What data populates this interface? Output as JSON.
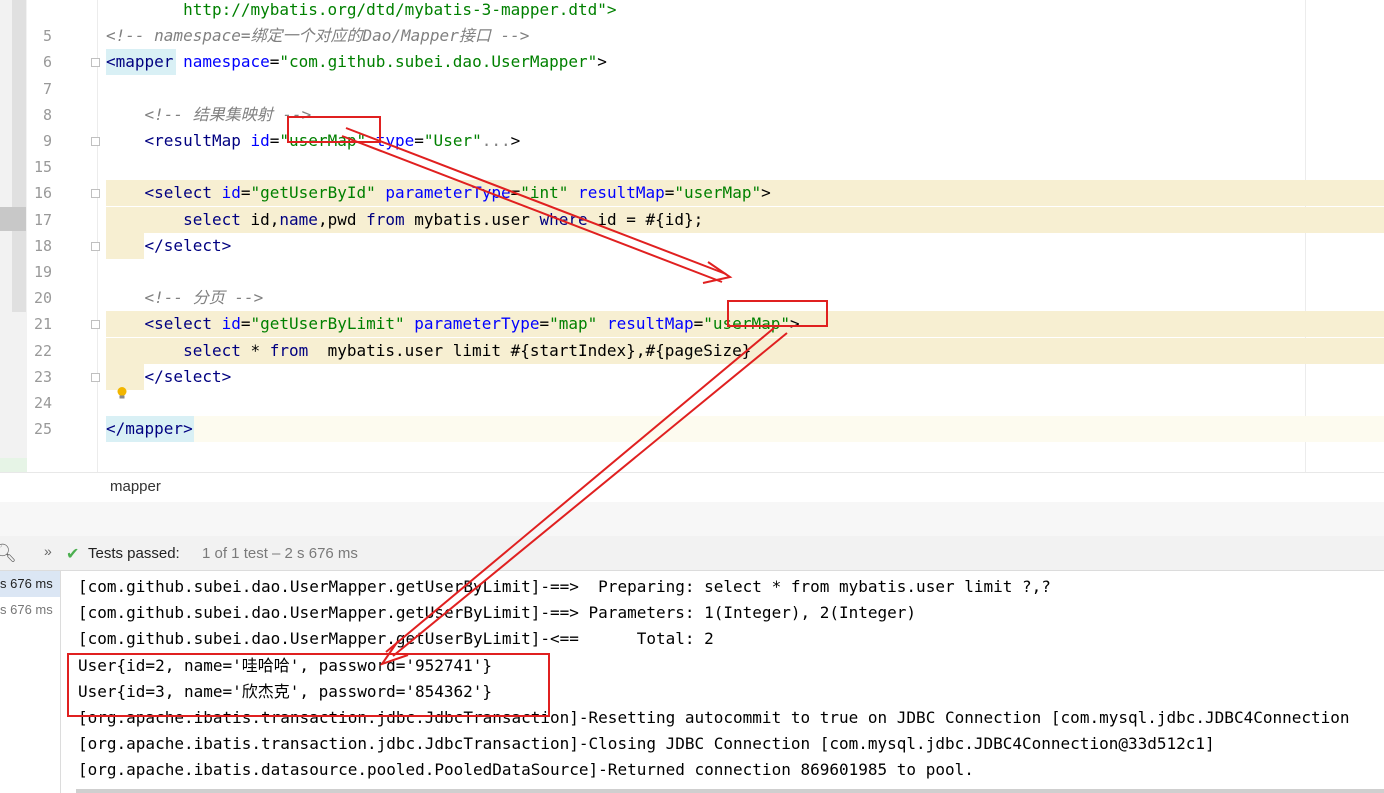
{
  "editor": {
    "lines": [
      {
        "num": "",
        "segments": [
          {
            "t": "        http://mybatis.org/dtd/mybatis-3-mapper.dtd\">",
            "c": "c-val"
          }
        ]
      },
      {
        "num": "5",
        "segments": [
          {
            "t": "<!-- namespace=绑定一个对应的Dao/Mapper接口 -->",
            "c": "c-comment"
          }
        ]
      },
      {
        "num": "6",
        "segments": [
          {
            "t": "<mapper",
            "c": "c-tag"
          },
          {
            "t": " namespace",
            "c": "c-attr"
          },
          {
            "t": "=",
            "c": ""
          },
          {
            "t": "\"com.github.subei.dao.UserMapper\"",
            "c": "c-val"
          },
          {
            "t": ">",
            "c": ""
          }
        ]
      },
      {
        "num": "7",
        "segments": []
      },
      {
        "num": "8",
        "segments": [
          {
            "t": "    <!-- 结果集映射 -->",
            "c": "c-comment"
          }
        ]
      },
      {
        "num": "9",
        "segments": [
          {
            "t": "    <resultMap",
            "c": "c-tag"
          },
          {
            "t": " id",
            "c": "c-attr"
          },
          {
            "t": "=",
            "c": ""
          },
          {
            "t": "\"userMap\"",
            "c": "c-val"
          },
          {
            "t": " type",
            "c": "c-attr"
          },
          {
            "t": "=",
            "c": ""
          },
          {
            "t": "\"User\"",
            "c": "c-val"
          },
          {
            "t": "...",
            "c": "c-dim"
          },
          {
            "t": ">",
            "c": ""
          }
        ]
      },
      {
        "num": "15",
        "segments": []
      },
      {
        "num": "16",
        "segments": [
          {
            "t": "    <select",
            "c": "c-tag"
          },
          {
            "t": " id",
            "c": "c-attr"
          },
          {
            "t": "=",
            "c": ""
          },
          {
            "t": "\"getUserById\"",
            "c": "c-val"
          },
          {
            "t": " parameterType",
            "c": "c-attr"
          },
          {
            "t": "=",
            "c": ""
          },
          {
            "t": "\"int\"",
            "c": "c-val"
          },
          {
            "t": " resultMap",
            "c": "c-attr"
          },
          {
            "t": "=",
            "c": ""
          },
          {
            "t": "\"userMap\"",
            "c": "c-val"
          },
          {
            "t": ">",
            "c": ""
          }
        ]
      },
      {
        "num": "17",
        "segments": [
          {
            "t": "        select ",
            "c": "c-kw"
          },
          {
            "t": "id",
            "c": ""
          },
          {
            "t": ",",
            "c": ""
          },
          {
            "t": "name",
            "c": "c-kw"
          },
          {
            "t": ",pwd ",
            "c": ""
          },
          {
            "t": "from",
            "c": "c-kw"
          },
          {
            "t": " mybatis.user ",
            "c": ""
          },
          {
            "t": "where",
            "c": "c-kw"
          },
          {
            "t": " id = #{id};",
            "c": ""
          }
        ]
      },
      {
        "num": "18",
        "segments": [
          {
            "t": "    </select>",
            "c": "c-tag"
          }
        ]
      },
      {
        "num": "19",
        "segments": []
      },
      {
        "num": "20",
        "segments": [
          {
            "t": "    <!-- 分页 -->",
            "c": "c-comment"
          }
        ]
      },
      {
        "num": "21",
        "segments": [
          {
            "t": "    <select",
            "c": "c-tag"
          },
          {
            "t": " id",
            "c": "c-attr"
          },
          {
            "t": "=",
            "c": ""
          },
          {
            "t": "\"getUserByLimit\"",
            "c": "c-val"
          },
          {
            "t": " parameterType",
            "c": "c-attr"
          },
          {
            "t": "=",
            "c": ""
          },
          {
            "t": "\"map\"",
            "c": "c-val"
          },
          {
            "t": " resultMap",
            "c": "c-attr"
          },
          {
            "t": "=",
            "c": ""
          },
          {
            "t": "\"userMap\"",
            "c": "c-val"
          },
          {
            "t": ">",
            "c": ""
          }
        ]
      },
      {
        "num": "22",
        "segments": [
          {
            "t": "        select",
            "c": "c-kw"
          },
          {
            "t": " * ",
            "c": ""
          },
          {
            "t": "from",
            "c": "c-kw"
          },
          {
            "t": "  mybatis.user limit #{startIndex},#{pageSize}",
            "c": ""
          }
        ]
      },
      {
        "num": "23",
        "segments": [
          {
            "t": "    </select>",
            "c": "c-tag"
          }
        ]
      },
      {
        "num": "24",
        "segments": []
      },
      {
        "num": "25",
        "segments": [
          {
            "t": "</mapper>",
            "c": "c-tag"
          }
        ]
      }
    ]
  },
  "breadcrumb": {
    "label": "mapper"
  },
  "run": {
    "status_label": "Tests passed:",
    "status_detail": "1 of 1 test – 2 s 676 ms",
    "tree": [
      "s 676 ms",
      "s 676 ms"
    ]
  },
  "console": {
    "lines": [
      "[com.github.subei.dao.UserMapper.getUserByLimit]-==>  Preparing: select * from mybatis.user limit ?,?",
      "[com.github.subei.dao.UserMapper.getUserByLimit]-==> Parameters: 1(Integer), 2(Integer)",
      "[com.github.subei.dao.UserMapper.getUserByLimit]-<==      Total: 2",
      "User{id=2, name='哇哈哈', password='952741'}",
      "User{id=3, name='欣杰克', password='854362'}",
      "[org.apache.ibatis.transaction.jdbc.JdbcTransaction]-Resetting autocommit to true on JDBC Connection [com.mysql.jdbc.JDBC4Connection",
      "[org.apache.ibatis.transaction.jdbc.JdbcTransaction]-Closing JDBC Connection [com.mysql.jdbc.JDBC4Connection@33d512c1]",
      "[org.apache.ibatis.datasource.pooled.PooledDataSource]-Returned connection 869601985 to pool."
    ]
  },
  "colors": {
    "annotation": "#e02020",
    "highlight": "#f7efd2",
    "check": "#4caf50"
  },
  "icons": [
    "search-icon",
    "expand-icon",
    "check-icon",
    "lightbulb-icon",
    "fold-icon"
  ]
}
